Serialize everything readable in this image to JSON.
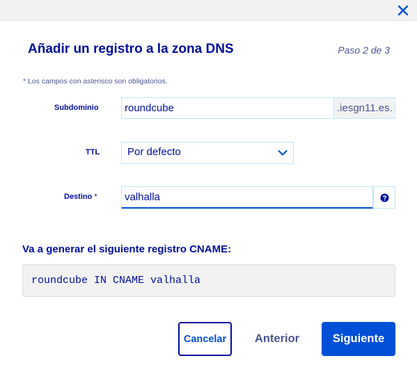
{
  "dialog": {
    "close_icon": "close-icon",
    "title": "Añadir un registro a la zona DNS",
    "step": "Paso 2 de 3",
    "required_note": "*  Los campos con asterisco son obligatorios."
  },
  "form": {
    "subdomain": {
      "label": "Subdominio",
      "value": "roundcube",
      "suffix": ".iesgn11.es."
    },
    "ttl": {
      "label": "TTL",
      "selected": "Por defecto",
      "icon": "chevron-down-icon"
    },
    "target": {
      "label": "Destino",
      "required_mark": "*",
      "value": "valhalla",
      "help_icon": "question-circle-icon"
    }
  },
  "preview": {
    "label": "Va a generar el siguiente registro CNAME:",
    "record": "roundcube IN CNAME valhalla"
  },
  "buttons": {
    "cancel": "Cancelar",
    "previous": "Anterior",
    "next": "Siguiente"
  },
  "colors": {
    "primary": "#0050d7",
    "text": "#000e9c",
    "border": "#bbe7f6",
    "muted_background": "#f2f2f2"
  }
}
